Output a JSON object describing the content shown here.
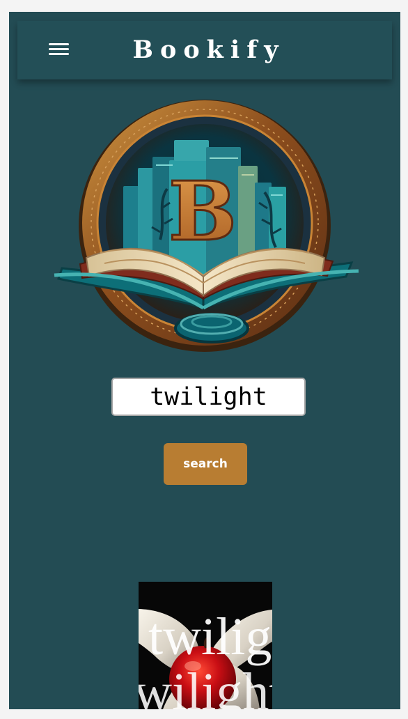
{
  "header": {
    "title": "Bookify",
    "menu_icon": "hamburger-menu-icon"
  },
  "logo": {
    "letter": "B",
    "colors": {
      "ring": "#8b4d1d",
      "teal": "#1f8b91",
      "book_page": "#eadbb7",
      "letter": "#c97d36"
    }
  },
  "search": {
    "value": "twilight",
    "button_label": "search"
  },
  "results": [
    {
      "cover_text": "twilight"
    }
  ],
  "colors": {
    "page_bg": "#234c54",
    "button_bg": "#b87d32",
    "input_bg": "#ffffff"
  }
}
